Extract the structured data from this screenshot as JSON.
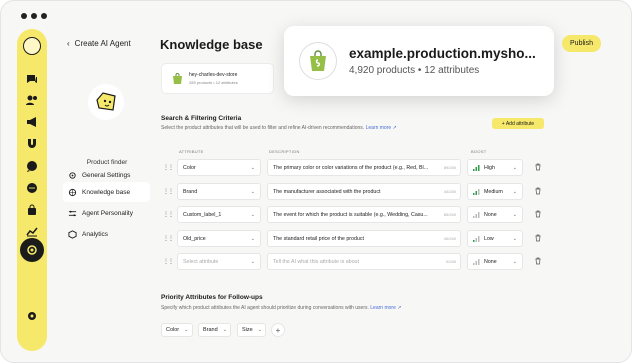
{
  "header": {
    "title": "Knowledge base",
    "publish_label": "Publish"
  },
  "subnav": {
    "back_label": "Create AI Agent",
    "agent_name": "Product finder",
    "items": [
      {
        "label": "General Settings",
        "icon": "gear-icon"
      },
      {
        "label": "Knowledge base",
        "icon": "globe-icon"
      },
      {
        "label": "Agent Personality",
        "icon": "sliders-icon"
      },
      {
        "label": "Analytics",
        "icon": "cube-icon"
      }
    ]
  },
  "store": {
    "name": "hey-charles-dev-store",
    "meta": "285 products • 12 attributes"
  },
  "popout": {
    "domain": "example.production.mysho...",
    "meta": "4,920 products • 12 attributes"
  },
  "search_section": {
    "title": "Search & Filtering Criteria",
    "desc": "Select the product attributes that will be used to filter and refine AI-driven recommendations.",
    "learn_more": "Learn more",
    "add_attribute": "+ Add attribute",
    "columns": {
      "attribute": "ATTRIBUTE",
      "description": "DESCRIPTION",
      "boost": "BOOST"
    },
    "rows": [
      {
        "attribute": "Color",
        "description": "The primary color or color variations of the product (e.g., Red, Bl...",
        "count": "89/240",
        "boost": "High",
        "boost_icon": "bars-high-icon"
      },
      {
        "attribute": "Brand",
        "description": "The manufacturer associated with the product",
        "count": "44/240",
        "boost": "Medium",
        "boost_icon": "bars-medium-icon"
      },
      {
        "attribute": "Custom_label_1",
        "description": "The event for which the product is suitable (e.g., Wedding, Casu...",
        "count": "85/240",
        "boost": "None",
        "boost_icon": "bars-none-icon"
      },
      {
        "attribute": "Old_price",
        "description": "The standard retail price of the product",
        "count": "40/240",
        "boost": "Low",
        "boost_icon": "bars-low-icon"
      }
    ],
    "empty_row": {
      "attribute_placeholder": "Select attribute",
      "description_placeholder": "Tell the AI what this attribute is about",
      "count": "0/240",
      "boost": "None"
    }
  },
  "priority_section": {
    "title": "Priority Attributes for Follow-ups",
    "desc": "Specify which product attributes the AI agent should prioritize during conversations with users.",
    "learn_more": "Learn more",
    "chips": [
      "Color",
      "Brand",
      "Size"
    ],
    "add_symbol": "+"
  },
  "colors": {
    "accent": "#f5e86a",
    "dark": "#1b1b1b",
    "link": "#4a6cd4"
  },
  "rail_icons": [
    "chat-icon",
    "people-icon",
    "megaphone-icon",
    "magnet-icon",
    "message-icon",
    "message-dots-icon",
    "bag-icon",
    "chart-icon",
    "agent-icon",
    "settings-icon"
  ]
}
